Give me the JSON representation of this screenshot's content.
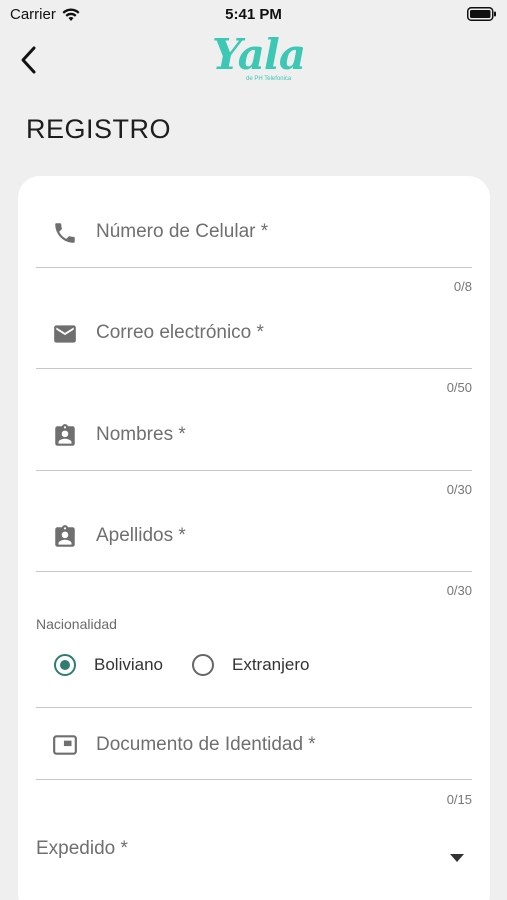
{
  "status_bar": {
    "carrier": "Carrier",
    "time": "5:41 PM"
  },
  "header": {
    "logo_text": "Yala",
    "logo_subtext": "de PH Telefonica",
    "brand_color": "#3cc8b4"
  },
  "page": {
    "title": "REGISTRO"
  },
  "form": {
    "fields": [
      {
        "icon": "phone-icon",
        "label": "Número de Celular *",
        "counter": "0/8"
      },
      {
        "icon": "mail-icon",
        "label": "Correo electrónico *",
        "counter": "0/50"
      },
      {
        "icon": "id-badge-icon",
        "label": "Nombres *",
        "counter": "0/30"
      },
      {
        "icon": "id-badge-icon",
        "label": "Apellidos *",
        "counter": "0/30"
      }
    ],
    "nationality": {
      "label": "Nacionalidad",
      "options": [
        "Boliviano",
        "Extranjero"
      ],
      "selected": "Boliviano",
      "accent_color": "#2f7d71"
    },
    "document": {
      "icon": "id-card-icon",
      "label": "Documento de Identidad *",
      "counter": "0/15"
    },
    "expedido": {
      "label": "Expedido *"
    }
  }
}
